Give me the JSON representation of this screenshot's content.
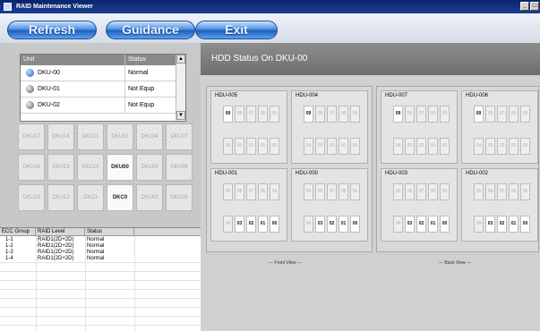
{
  "window": {
    "title": "RAID Maintenance Viewer"
  },
  "toolbar": {
    "refresh": "Refresh",
    "guidance": "Guidance",
    "exit": "Exit"
  },
  "units": {
    "headers": [
      "Unit",
      "Status"
    ],
    "rows": [
      {
        "name": "DKU-00",
        "status": "Normal",
        "icon": "blue-disk-icon"
      },
      {
        "name": "DKU-01",
        "status": "Not Equp",
        "icon": "gray-disk-icon"
      },
      {
        "name": "DKU-02",
        "status": "Not Equp",
        "icon": "gray-disk-icon"
      }
    ]
  },
  "grid": [
    [
      "DKU17",
      "DKU14",
      "DKU11",
      "DKU01",
      "DKU04",
      "DKU07"
    ],
    [
      "DKU16",
      "DKU13",
      "DKU10",
      "DKU00",
      "DKU03",
      "DKU06"
    ],
    [
      "DKU15",
      "DKU12",
      "DKC1",
      "DKC0",
      "DKU02",
      "DKU05"
    ]
  ],
  "ecc": {
    "headers": [
      "ECC Group",
      "RAID Level",
      "Status"
    ],
    "rows": [
      [
        "1-1",
        "RAID1(2D+2D)",
        "Normal"
      ],
      [
        "1-2",
        "RAID1(2D+2D)",
        "Normal"
      ],
      [
        "1-3",
        "RAID1(2D+2D)",
        "Normal"
      ],
      [
        "1-4",
        "RAID1(2D+2D)",
        "Normal"
      ]
    ]
  },
  "hdd": {
    "title": "HDD Status On DKU-00",
    "front_label": "--- Front View ---",
    "back_label": "--- Back View ---",
    "front": [
      {
        "name": "HDU-005",
        "top": [
          "09",
          "08",
          "07",
          "06",
          "05"
        ],
        "bottom": [
          "04",
          "03",
          "02",
          "01",
          "00"
        ],
        "active_top": [
          "09"
        ],
        "active_bottom": []
      },
      {
        "name": "HDU-004",
        "top": [
          "09",
          "08",
          "07",
          "06",
          "05"
        ],
        "bottom": [
          "04",
          "03",
          "02",
          "01",
          "00"
        ],
        "active_top": [
          "09"
        ],
        "active_bottom": []
      },
      {
        "name": "HDU-001",
        "top": [
          "09",
          "08",
          "07",
          "06",
          "05"
        ],
        "bottom": [
          "04",
          "03",
          "02",
          "01",
          "00"
        ],
        "active_top": [],
        "active_bottom": [
          "03",
          "02",
          "01",
          "00"
        ]
      },
      {
        "name": "HDU-000",
        "top": [
          "09",
          "08",
          "07",
          "06",
          "05"
        ],
        "bottom": [
          "04",
          "03",
          "02",
          "01",
          "00"
        ],
        "active_top": [],
        "active_bottom": [
          "03",
          "02",
          "01",
          "00"
        ]
      }
    ],
    "back": [
      {
        "name": "HDU-007",
        "top": [
          "09",
          "08",
          "07",
          "06",
          "05"
        ],
        "bottom": [
          "04",
          "03",
          "02",
          "01",
          "00"
        ],
        "active_top": [
          "09"
        ],
        "active_bottom": []
      },
      {
        "name": "HDU-006",
        "top": [
          "09",
          "08",
          "07",
          "06",
          "05"
        ],
        "bottom": [
          "04",
          "03",
          "02",
          "01",
          "00"
        ],
        "active_top": [
          "09"
        ],
        "active_bottom": []
      },
      {
        "name": "HDU-003",
        "top": [
          "09",
          "08",
          "07",
          "06",
          "05"
        ],
        "bottom": [
          "04",
          "03",
          "02",
          "01",
          "00"
        ],
        "active_top": [],
        "active_bottom": [
          "03",
          "02",
          "01",
          "00"
        ]
      },
      {
        "name": "HDU-002",
        "top": [
          "09",
          "08",
          "07",
          "06",
          "05"
        ],
        "bottom": [
          "04",
          "03",
          "02",
          "01",
          "00"
        ],
        "active_top": [],
        "active_bottom": [
          "03",
          "02",
          "01",
          "00"
        ]
      }
    ]
  }
}
